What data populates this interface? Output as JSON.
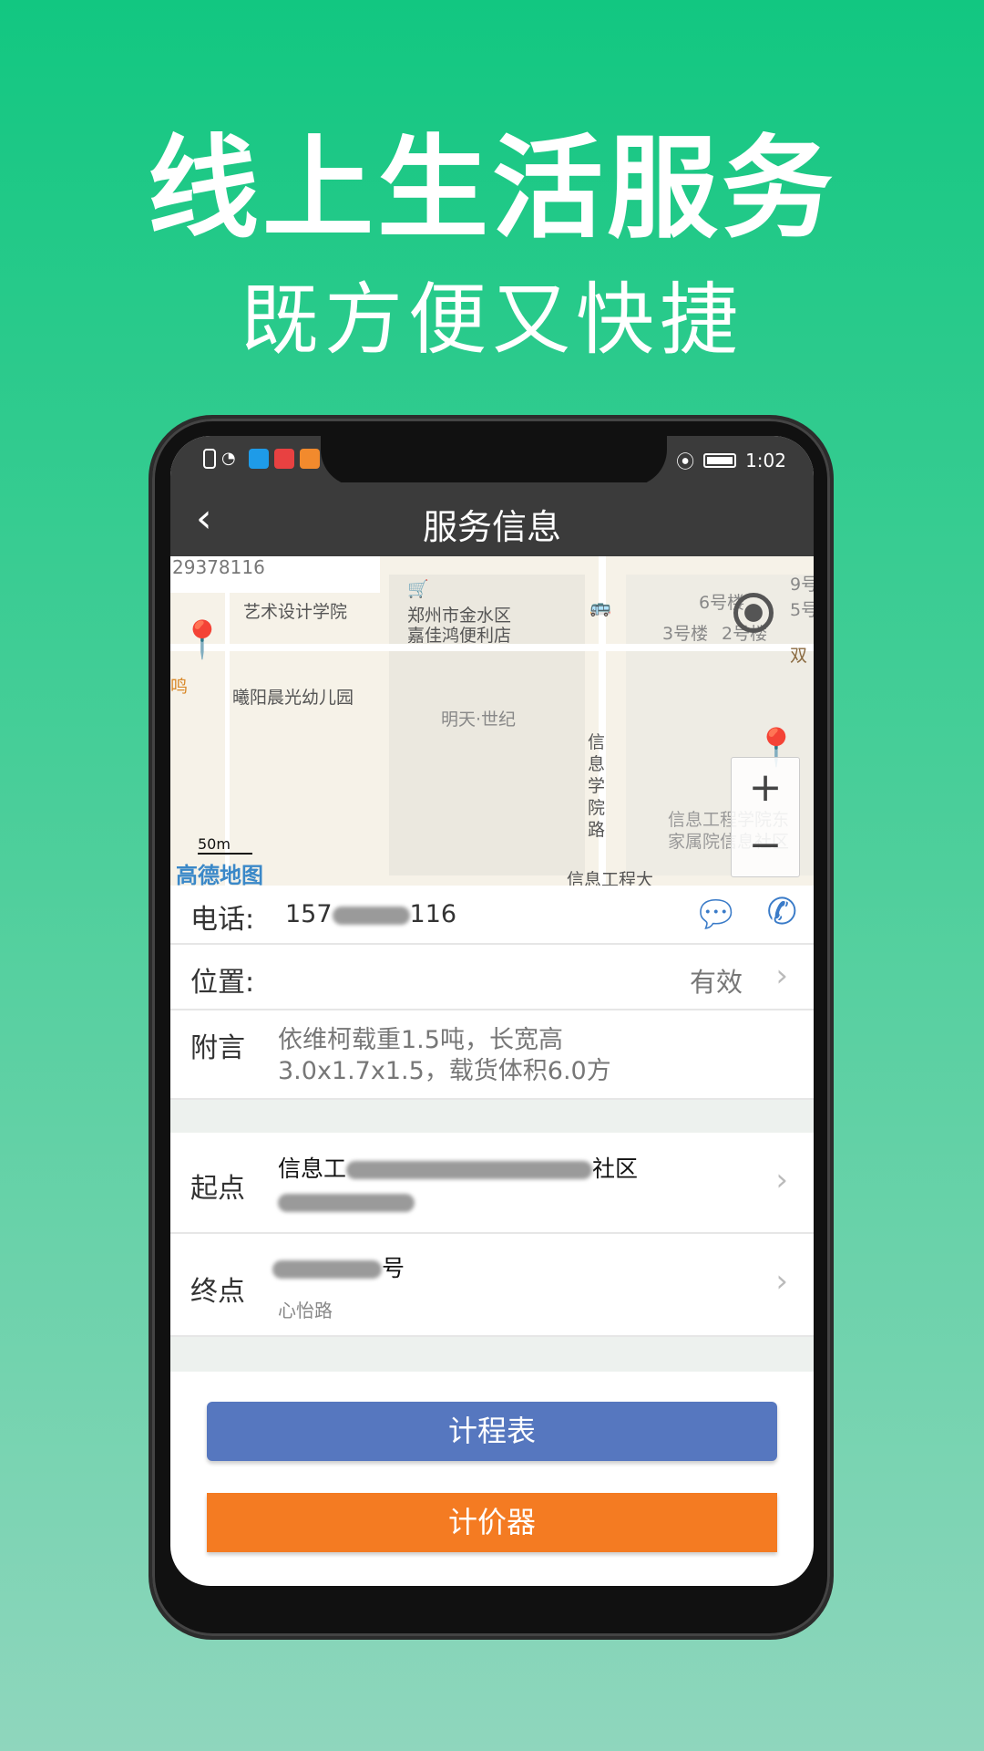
{
  "promo": {
    "headline": "线上生活服务",
    "subheadline": "既方便又快捷"
  },
  "status_bar": {
    "time": "1:02"
  },
  "header": {
    "title": "服务信息",
    "back_icon": "chevron-left-icon"
  },
  "map": {
    "labels": {
      "number": "29378116",
      "school": "艺术设计学院",
      "store1": "郑州市金水区",
      "store2": "嘉佳鸿便利店",
      "kinder": "曦阳晨光幼儿园",
      "community": "明天·世纪",
      "road": "信息学院路",
      "b6": "6号楼",
      "b3": "3号楼",
      "b2": "2号楼",
      "b9": "9号",
      "b5": "5号",
      "shuang": "双",
      "info1": "信息工程学院东",
      "info2": "家属院信息社区",
      "info3": "信息工程大",
      "edge": "鸣"
    },
    "scale": "50m",
    "logo": "高德地图",
    "zoom_in": "+",
    "zoom_out": "−"
  },
  "contact": {
    "label": "电话:",
    "phone_visible_start": "157",
    "phone_visible_end": "116"
  },
  "location": {
    "label": "位置:",
    "value": "有效"
  },
  "note": {
    "label": "附言",
    "text_line1": "依维柯载重1.5吨，长宽高",
    "text_line2": "3.0x1.7x1.5，载货体积6.0方"
  },
  "start": {
    "label": "起点",
    "address_start": "信息工",
    "address_end": "社区"
  },
  "end": {
    "label": "终点",
    "address_end": "号",
    "sub": "心怡路"
  },
  "buttons": {
    "meter": "计程表",
    "pricer": "计价器"
  },
  "colors": {
    "meter": "#5677bf",
    "pricer": "#f47b22",
    "accent": "#3a7bc8"
  }
}
